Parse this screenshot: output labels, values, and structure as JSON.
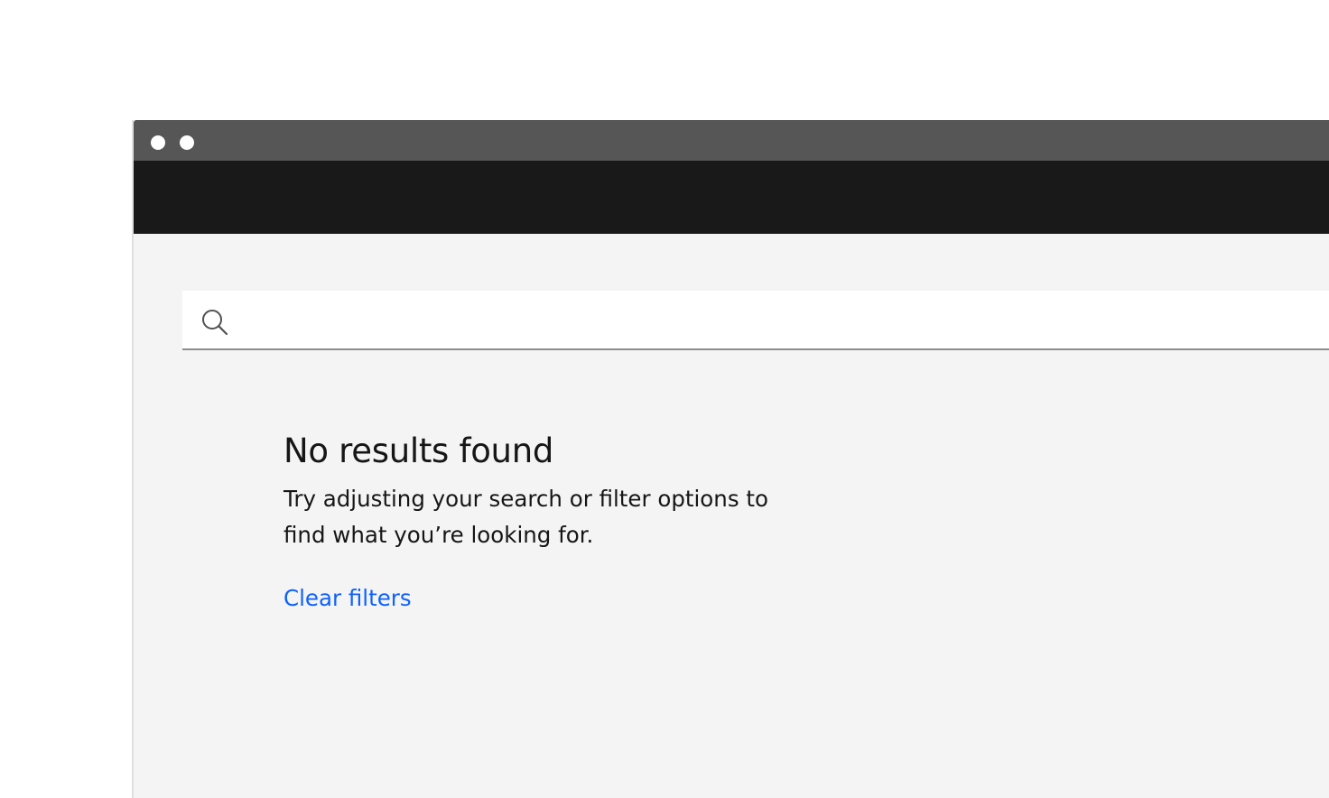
{
  "search": {
    "value": "",
    "placeholder": ""
  },
  "empty_state": {
    "title": "No results found",
    "description": "Try adjusting your search or filter options to find what you’re looking for.",
    "clear_filters_label": "Clear filters"
  },
  "icons": {
    "search": "search-icon",
    "window_controls": [
      "window-dot",
      "window-dot"
    ]
  },
  "colors": {
    "title_bar": "#565656",
    "app_header": "#191919",
    "content_background": "#f4f4f4",
    "link": "#0f62fe",
    "text": "#161616"
  }
}
